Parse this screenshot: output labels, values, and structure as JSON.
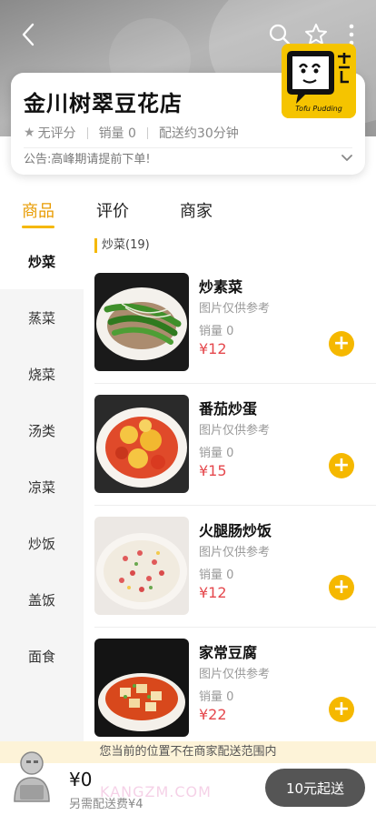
{
  "shop": {
    "name": "金川树翠豆花店",
    "rating": "无评分",
    "sales": "销量 0",
    "delivery": "配送约30分钟",
    "notice": "公告:高峰期请提前下单!",
    "logo_text": "Tofu Pudding"
  },
  "tabs": [
    {
      "label": "商品",
      "active": true
    },
    {
      "label": "评价",
      "active": false
    },
    {
      "label": "商家",
      "active": false
    }
  ],
  "sidebar": {
    "items": [
      {
        "label": "炒菜",
        "active": true
      },
      {
        "label": "蒸菜",
        "active": false
      },
      {
        "label": "烧菜",
        "active": false
      },
      {
        "label": "汤类",
        "active": false
      },
      {
        "label": "凉菜",
        "active": false
      },
      {
        "label": "炒饭",
        "active": false
      },
      {
        "label": "盖饭",
        "active": false
      },
      {
        "label": "面食",
        "active": false
      }
    ]
  },
  "section": {
    "title": "炒菜(19)"
  },
  "dishes": [
    {
      "name": "炒素菜",
      "note": "图片仅供参考",
      "sales": "销量 0",
      "price": "¥12"
    },
    {
      "name": "番茄炒蛋",
      "note": "图片仅供参考",
      "sales": "销量 0",
      "price": "¥15"
    },
    {
      "name": "火腿肠炒饭",
      "note": "图片仅供参考",
      "sales": "销量 0",
      "price": "¥12"
    },
    {
      "name": "家常豆腐",
      "note": "图片仅供参考",
      "sales": "销量 0",
      "price": "¥22"
    }
  ],
  "bottom": {
    "out_of_range": "您当前的位置不在商家配送范围内",
    "total": "¥0",
    "extra_fee": "另需配送费¥4",
    "min_order": "10元起送",
    "watermark": "KANGZM.COM"
  },
  "colors": {
    "accent": "#f5b800",
    "price": "#e5484d",
    "active_tab": "#e89b00"
  },
  "icons": [
    "back-icon",
    "search-icon",
    "star-outline-icon",
    "more-vertical-icon",
    "star-icon",
    "chevron-down-icon",
    "plus-icon"
  ]
}
